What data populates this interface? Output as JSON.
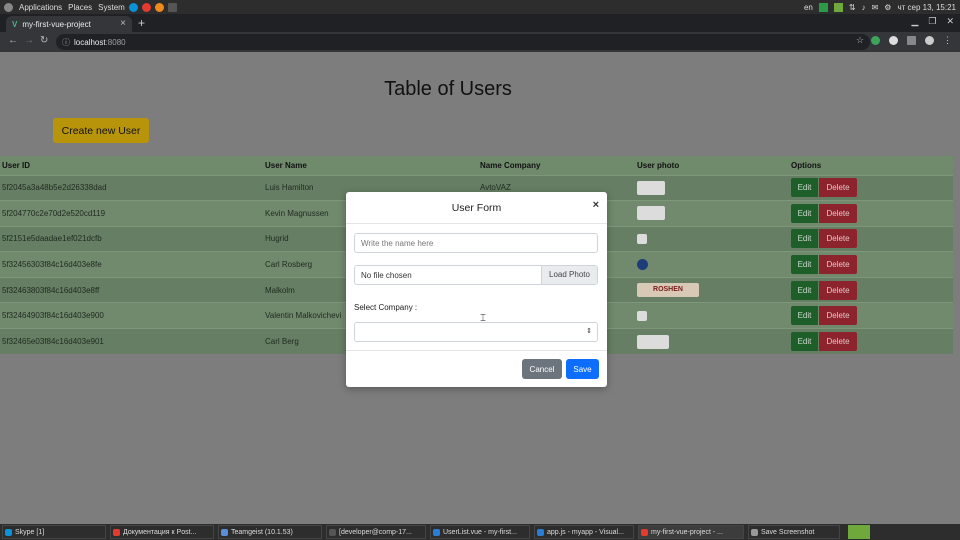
{
  "os_panel": {
    "menu": [
      "Applications",
      "Places",
      "System"
    ],
    "lang": "en",
    "clock": "чт сер 13, 15:21"
  },
  "browser": {
    "tab_title": "my-first-vue-project",
    "url_host": "localhost",
    "url_port": ":8080"
  },
  "page": {
    "title": "Table of Users",
    "create_button": "Create new User",
    "columns": [
      "User ID",
      "User Name",
      "Name Company",
      "User photo",
      "Options"
    ],
    "rows": [
      {
        "id": "5f2045a3a48b5e2d26338dad",
        "name": "Luis Hamilton",
        "company": "AvtoVAZ",
        "photo": "logo"
      },
      {
        "id": "5f204770c2e70d2e520cd119",
        "name": "Kevin Magnussen",
        "company": "",
        "photo": "logo"
      },
      {
        "id": "5f2151e5daadae1ef021dcfb",
        "name": "Hugrid",
        "company": "",
        "photo": "small"
      },
      {
        "id": "5f32456303f84c16d403e8fe",
        "name": "Carl Rosberg",
        "company": "",
        "photo": "round"
      },
      {
        "id": "5f32463803f84c16d403e8ff",
        "name": "Malkolm",
        "company": "",
        "photo": "wide"
      },
      {
        "id": "5f32464903f84c16d403e900",
        "name": "Valentin Malkovichevi",
        "company": "",
        "photo": "small"
      },
      {
        "id": "5f32465e03f84c16d403e901",
        "name": "Carl Berg",
        "company": "",
        "photo": "logo"
      }
    ],
    "edit_label": "Edit",
    "delete_label": "Delete",
    "photo_wide_text": "ROSHEN"
  },
  "modal": {
    "title": "User Form",
    "close": "×",
    "name_placeholder": "Write the name here",
    "file_text": "No file chosen",
    "load_photo": "Load Photo",
    "company_label": "Select Company :",
    "select_arrow": "⇕",
    "cancel": "Cancel",
    "save": "Save"
  },
  "taskbar": {
    "items": [
      "Skype [1]",
      "Документация к Post...",
      "Teamgeist (10.1.53)",
      "[developer@comp-17...",
      "UserList.vue - my-first...",
      "app.js - myapp - Visual...",
      "my-first-vue-project - ...",
      "Save Screenshot"
    ]
  },
  "colors": {
    "accent_primary": "#0d6efd",
    "create_button": "#b8940b",
    "edit": "#1d5e29",
    "delete": "#8d232c"
  }
}
